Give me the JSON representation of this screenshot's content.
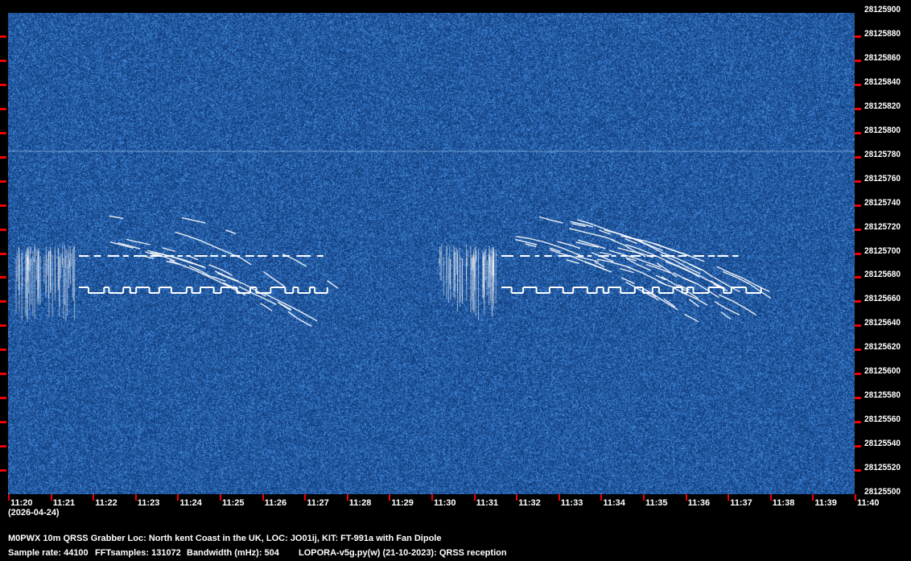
{
  "freq_labels": [
    "28125900",
    "28125880",
    "28125860",
    "28125840",
    "28125820",
    "28125800",
    "28125780",
    "28125760",
    "28125740",
    "28125720",
    "28125700",
    "28125680",
    "28125660",
    "28125640",
    "28125620",
    "28125600",
    "28125580",
    "28125560",
    "28125540",
    "28125520",
    "28125500"
  ],
  "time_labels": [
    "11:20",
    "11:21",
    "11:22",
    "11:23",
    "11:24",
    "11:25",
    "11:26",
    "11:27",
    "11:28",
    "11:29",
    "11:30",
    "11:31",
    "11:32",
    "11:33",
    "11:34",
    "11:35",
    "11:36",
    "11:37",
    "11:38",
    "11:39",
    "11:40"
  ],
  "date": "(2026-04-24)",
  "info_line1": "M0PWX 10m QRSS Grabber Loc: North kent Coast in the UK, LOC: JO01ij, KIT: FT-991a with Fan Dipole",
  "info_line2": {
    "sample_rate": "Sample rate: 44100",
    "fft": "FFTsamples: 131072",
    "bandwidth": "Bandwidth (mHz): 504",
    "software": "LOPORA-v5g.py(w) (21-10-2023): QRSS reception"
  },
  "colors": {
    "background": "#1d4f8f",
    "signal": "#ffffff",
    "tick": "#e00000"
  }
}
